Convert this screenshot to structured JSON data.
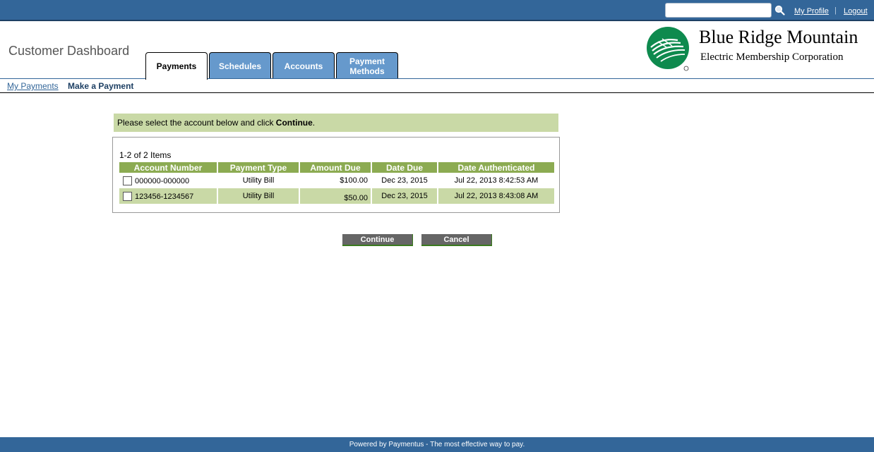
{
  "topbar": {
    "search_placeholder": "",
    "my_profile": "My Profile",
    "separator": "|",
    "logout": "Logout"
  },
  "header": {
    "title": "Customer Dashboard",
    "tabs": [
      {
        "label": "Payments",
        "active": true
      },
      {
        "label": "Schedules",
        "active": false
      },
      {
        "label": "Accounts",
        "active": false
      },
      {
        "label": "Payment Methods",
        "active": false
      }
    ],
    "brand": {
      "name": "Blue Ridge Mountain",
      "subtitle": "Electric Membership Corporation"
    }
  },
  "subnav": {
    "my_payments": "My Payments",
    "make_payment": "Make a Payment"
  },
  "instruction": {
    "text_before": "Please select the account below and click ",
    "bold": "Continue",
    "text_after": "."
  },
  "table": {
    "count": "1-2 of 2 Items",
    "headers": [
      "Account Number",
      "Payment Type",
      "Amount Due",
      "Date Due",
      "Date Authenticated"
    ],
    "rows": [
      {
        "account": "000000-000000",
        "type": "Utility Bill",
        "amount": "$100.00",
        "due": "Dec 23, 2015",
        "authenticated": "Jul 22, 2013 8:42:53 AM",
        "checked": false
      },
      {
        "account": "123456-1234567",
        "type": "Utility Bill",
        "amount": "$50.00",
        "due": "Dec 23, 2015",
        "authenticated": "Jul 22, 2013 8:43:08 AM",
        "checked": false
      }
    ]
  },
  "buttons": {
    "continue": "Continue",
    "cancel": "Cancel"
  },
  "footer": {
    "text": "Powered by Paymentus - The most effective way to pay."
  },
  "colors": {
    "topbar": "#336699",
    "tab_inactive": "#6699cc",
    "table_header": "#8cab52",
    "row_alt": "#c9d9a6",
    "button": "#666666",
    "logo_green": "#0e8a4e"
  }
}
